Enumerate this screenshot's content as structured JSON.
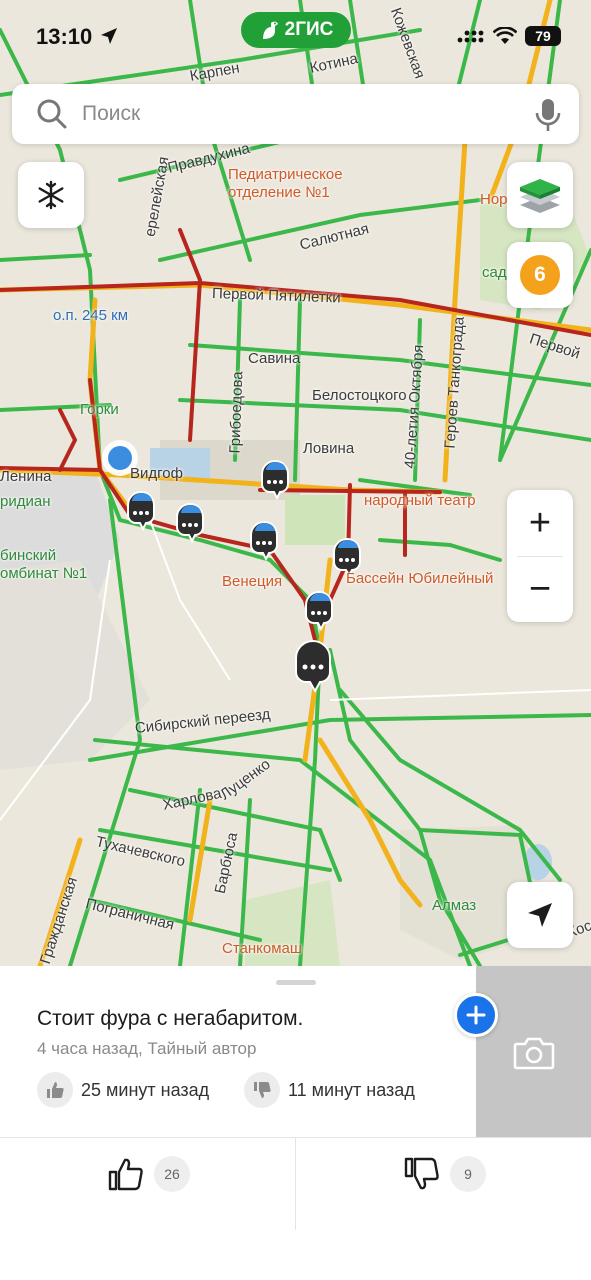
{
  "status_bar": {
    "time": "13:10",
    "battery": "79",
    "brand": "2ГИС",
    "brand_color": "#21a038"
  },
  "search": {
    "placeholder": "Поиск"
  },
  "map": {
    "traffic_score": "6",
    "traffic_score_color": "#f4a21c",
    "zoom_in": "+",
    "zoom_out": "−",
    "streets": [
      "Первой Пятилетки",
      "Первой",
      "Салютная",
      "Правдухина",
      "Карпен",
      "Котина",
      "Савина",
      "Белостоцкого",
      "Ловина",
      "Грибоедова",
      "40-летия Октября",
      "Героев Танкограда",
      "Сибирский переезд",
      "Харлова",
      "Луценко",
      "Тухачевского",
      "Барбюса",
      "Пограничная",
      "Гражданская",
      "ерелейская",
      "Ленина",
      "Кожевская",
      "Косарева"
    ],
    "places": [
      "Педиатрическое",
      "отделение №1",
      "о.п. 245 км",
      "Горки",
      "Видгоф",
      "ридиан",
      "бинский",
      "омбинат №1",
      "Венеция",
      "Бассейн Юбилейный",
      "народный театр",
      "Алмаз",
      "Станкомаш",
      "Нор",
      "сад"
    ],
    "icons": [
      "snowflake-icon",
      "layers-icon",
      "locate-arrow-icon",
      "road-event-icon",
      "user-location-dot"
    ]
  },
  "event": {
    "title": "Стоит фура с негабаритом.",
    "meta": "4 часа назад, Тайный автор",
    "confirm_time": "25 минут назад",
    "deny_time": "11 минут назад",
    "likes": "26",
    "dislikes": "9"
  }
}
